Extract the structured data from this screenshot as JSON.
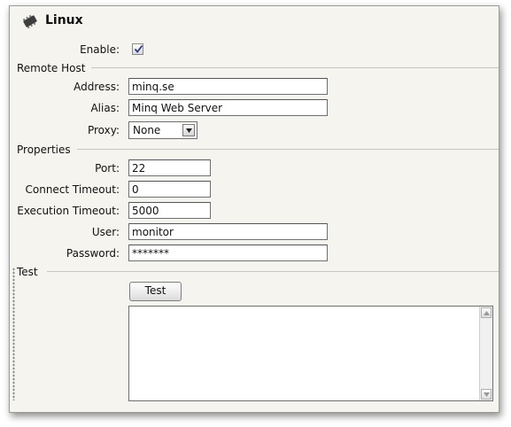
{
  "header": {
    "title": "Linux",
    "icon": "chip-icon"
  },
  "enable": {
    "label": "Enable:",
    "checked": true
  },
  "remote_host": {
    "section_title": "Remote Host",
    "address_label": "Address:",
    "address_value": "minq.se",
    "alias_label": "Alias:",
    "alias_value": "Minq Web Server",
    "proxy_label": "Proxy:",
    "proxy_value": "None"
  },
  "properties": {
    "section_title": "Properties",
    "port_label": "Port:",
    "port_value": "22",
    "connect_timeout_label": "Connect Timeout:",
    "connect_timeout_value": "0",
    "execution_timeout_label": "Execution Timeout:",
    "execution_timeout_value": "5000",
    "user_label": "User:",
    "user_value": "monitor",
    "password_label": "Password:",
    "password_value": "*******"
  },
  "test": {
    "section_title": "Test",
    "button_label": "Test",
    "output": ""
  }
}
